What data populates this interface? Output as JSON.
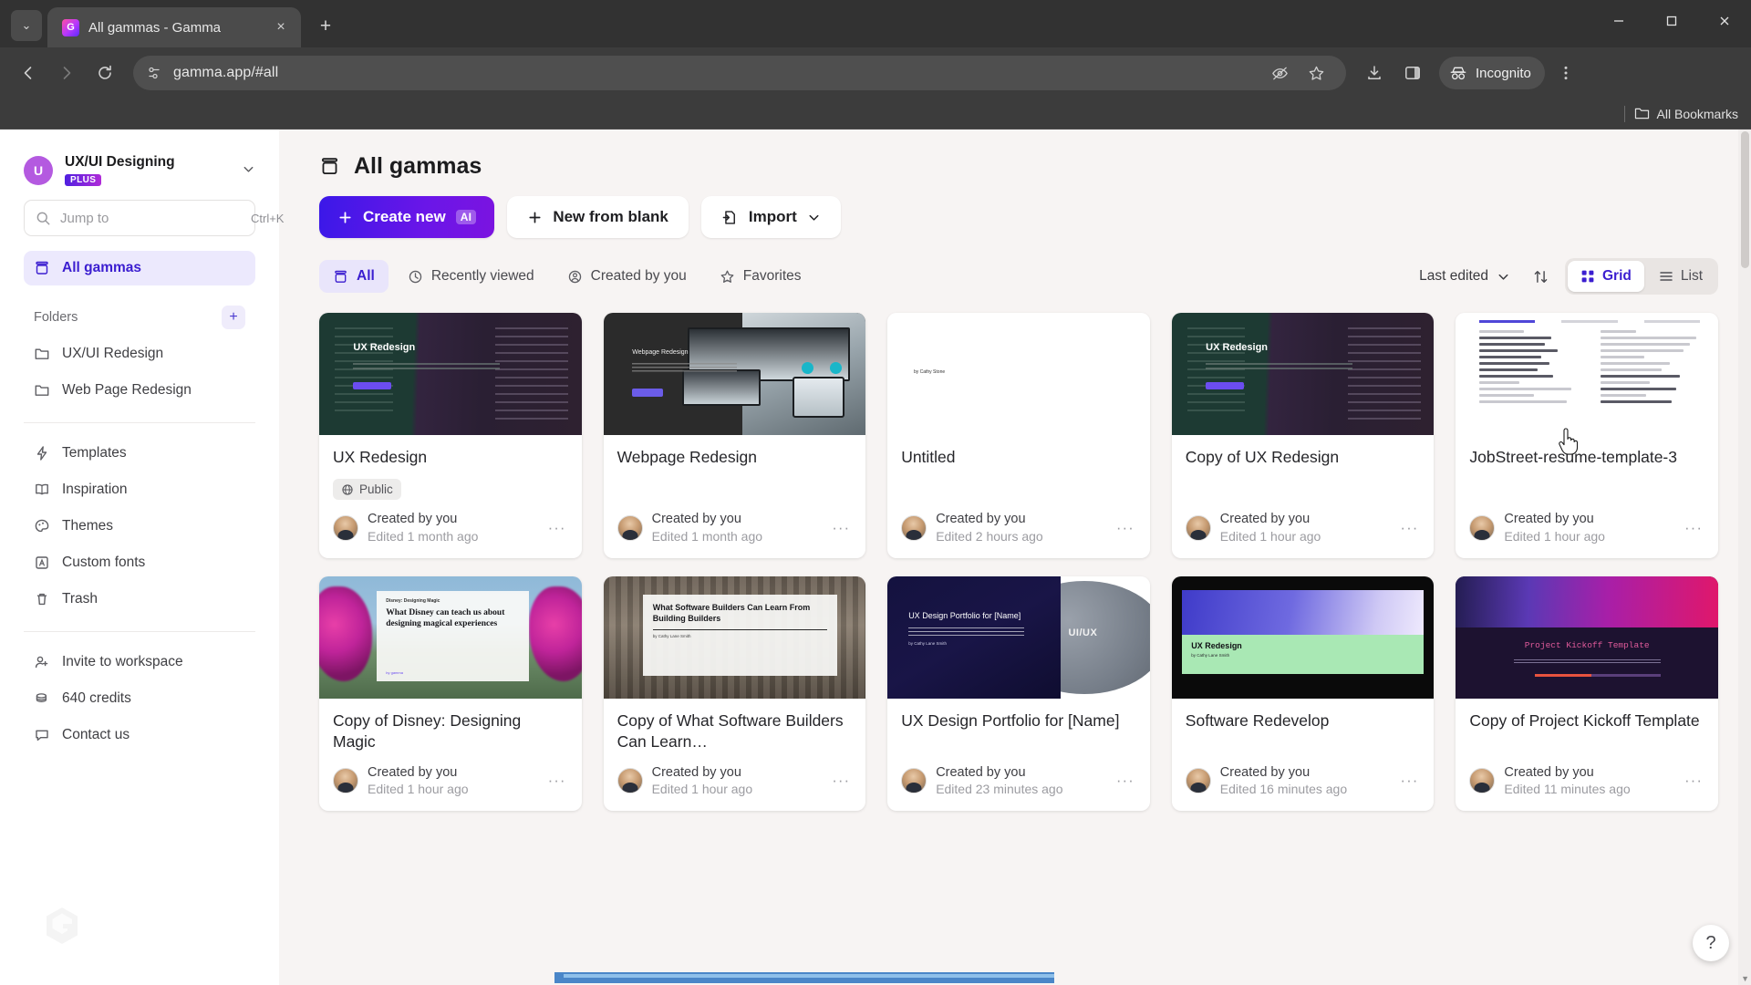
{
  "browser": {
    "tab": {
      "title": "All gammas - Gamma",
      "favicon": "gamma-logo-icon",
      "close": "×"
    },
    "new_tab_label": "+",
    "url": "gamma.app/#all",
    "incognito_label": "Incognito",
    "bookmarks_label": "All Bookmarks",
    "window_controls": {
      "minimize": "—",
      "maximize": "▢",
      "close": "✕"
    }
  },
  "sidebar": {
    "workspace": {
      "initial": "U",
      "name": "UX/UI Designing",
      "badge": "PLUS"
    },
    "search": {
      "placeholder": "Jump to",
      "shortcut": "Ctrl+K"
    },
    "primary_nav": [
      {
        "label": "All gammas",
        "icon": "gammas-icon",
        "active": true
      }
    ],
    "folders_section": {
      "title": "Folders",
      "add_label": "+"
    },
    "folders": [
      {
        "label": "UX/UI Redesign",
        "icon": "folder-icon"
      },
      {
        "label": "Web Page Redesign",
        "icon": "folder-icon"
      }
    ],
    "tools": [
      {
        "label": "Templates",
        "icon": "lightning-icon"
      },
      {
        "label": "Inspiration",
        "icon": "book-icon"
      },
      {
        "label": "Themes",
        "icon": "palette-icon"
      },
      {
        "label": "Custom fonts",
        "icon": "font-icon"
      },
      {
        "label": "Trash",
        "icon": "trash-icon"
      }
    ],
    "footer": [
      {
        "label": "Invite to workspace",
        "icon": "user-plus-icon"
      },
      {
        "label": "640 credits",
        "icon": "coins-icon"
      },
      {
        "label": "Contact us",
        "icon": "chat-icon"
      }
    ]
  },
  "main": {
    "page_title": "All gammas",
    "page_title_icon": "gammas-icon",
    "actions": [
      {
        "label": "Create new",
        "icon": "plus-icon",
        "chip": "AI",
        "variant": "primary"
      },
      {
        "label": "New from blank",
        "icon": "plus-icon",
        "variant": "default"
      },
      {
        "label": "Import",
        "icon": "import-icon",
        "variant": "default",
        "caret": "⌄"
      }
    ],
    "filters": [
      {
        "label": "All",
        "icon": "gammas-icon",
        "active": true
      },
      {
        "label": "Recently viewed",
        "icon": "clock-icon",
        "active": false
      },
      {
        "label": "Created by you",
        "icon": "user-icon",
        "active": false
      },
      {
        "label": "Favorites",
        "icon": "star-icon",
        "active": false
      }
    ],
    "sort": {
      "label": "Last edited",
      "caret": "⌄",
      "order_icon": "sort-arrows-icon"
    },
    "view_modes": [
      {
        "label": "Grid",
        "icon": "grid-icon",
        "active": true
      },
      {
        "label": "List",
        "icon": "list-icon",
        "active": false
      }
    ],
    "help_label": "?"
  },
  "cards": [
    {
      "title": "UX Redesign",
      "badge": "Public",
      "badge_icon": "globe-icon",
      "author": "Created by you",
      "edited": "Edited 1 month ago",
      "menu": "···",
      "thumb": "ux-redesign"
    },
    {
      "title": "Webpage Redesign",
      "badge": null,
      "author": "Created by you",
      "edited": "Edited 1 month ago",
      "menu": "···",
      "thumb": "webpage-redesign"
    },
    {
      "title": "Untitled",
      "badge": null,
      "author": "Created by you",
      "edited": "Edited 2 hours ago",
      "menu": "···",
      "thumb": "blank",
      "thumb_caption": "by Cathy Stone"
    },
    {
      "title": "Copy of UX Redesign",
      "badge": null,
      "author": "Created by you",
      "edited": "Edited 1 hour ago",
      "menu": "···",
      "thumb": "ux-redesign"
    },
    {
      "title": "JobStreet-resume-template-3",
      "badge": null,
      "author": "Created by you",
      "edited": "Edited 1 hour ago",
      "menu": "···",
      "thumb": "resume"
    },
    {
      "title": "Copy of Disney: Designing Magic",
      "badge": null,
      "author": "Created by you",
      "edited": "Edited 1 hour ago",
      "menu": "···",
      "thumb": "disney",
      "thumb_kicker": "Disney: Designing Magic",
      "thumb_heading": "What Disney can teach us about designing magical experiences"
    },
    {
      "title": "Copy of What Software Builders Can Learn…",
      "badge": null,
      "author": "Created by you",
      "edited": "Edited 1 hour ago",
      "menu": "···",
      "thumb": "software",
      "thumb_heading": "What Software Builders Can Learn From Building Builders",
      "thumb_byline": "by Cathy Lane Smith"
    },
    {
      "title": "UX Design Portfolio for [Name]",
      "badge": null,
      "author": "Created by you",
      "edited": "Edited 23 minutes ago",
      "menu": "···",
      "thumb": "portfolio",
      "thumb_heading": "UX Design Portfolio for [Name]",
      "thumb_byline": "by Cathy Lane Smith",
      "thumb_label": "UI/UX"
    },
    {
      "title": "Software Redevelop",
      "badge": null,
      "author": "Created by you",
      "edited": "Edited 16 minutes ago",
      "menu": "···",
      "thumb": "software-redevelop",
      "thumb_heading": "UX Redesign",
      "thumb_byline": "by Cathy Lane Smith"
    },
    {
      "title": "Copy of Project Kickoff Template",
      "badge": null,
      "author": "Created by you",
      "edited": "Edited 11 minutes ago",
      "menu": "···",
      "thumb": "kickoff",
      "thumb_heading": "Project Kickoff Template"
    }
  ]
}
